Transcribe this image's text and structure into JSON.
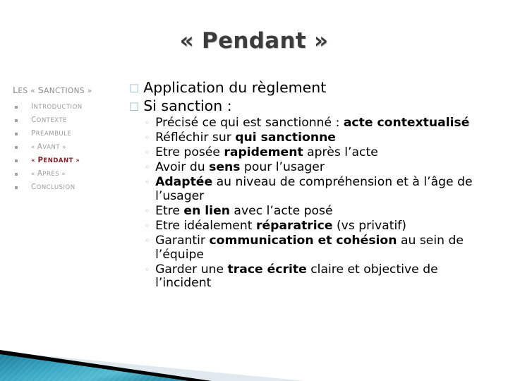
{
  "slide": {
    "title": "« Pendant »",
    "background_color": "#ffffff",
    "title_color": "#3c3c3c"
  },
  "sidebar": {
    "heading": "Les « sanctions »",
    "active_color": "#7b2026",
    "inactive_color": "#9a9a9a",
    "marker_icon": "square-bullet-icon",
    "items": [
      {
        "label": "Introduction",
        "active": false
      },
      {
        "label": "Contexte",
        "active": false
      },
      {
        "label": "Préambule",
        "active": false
      },
      {
        "label": "« Avant »",
        "active": false
      },
      {
        "label": "« Pendant »",
        "active": true
      },
      {
        "label": "« Après »",
        "active": false
      },
      {
        "label": "Conclusion",
        "active": false
      }
    ]
  },
  "content": {
    "level1_marker": "hollow-square-bullet-icon",
    "level1_marker_glyph": "□",
    "level1_marker_color": "#8fb8cc",
    "level2_marker": "hollow-circle-bullet-icon",
    "level2_marker_glyph": "◦",
    "level2_marker_color": "#7fb0c8",
    "bullets": [
      {
        "text": "Application du règlement"
      },
      {
        "text": "Si sanction :"
      }
    ],
    "subbullets": [
      {
        "html": "Précisé ce qui est sanctionné : <b>acte contextualisé</b>"
      },
      {
        "html": "Réfléchir sur <b>qui sanctionne</b>"
      },
      {
        "html": "Etre posée <b>rapidement</b> après l’acte"
      },
      {
        "html": "Avoir du <b>sens</b> pour l’usager"
      },
      {
        "html": "<b>Adaptée</b> au niveau de compréhension et à l’âge de l’usager"
      },
      {
        "html": "Etre <b>en lien</b> avec l’acte posé"
      },
      {
        "html": "Etre idéalement <b>réparatrice</b> (vs privatif)"
      },
      {
        "html": "Garantir <b>communication et cohésion</b> au sein de l’équipe"
      },
      {
        "html": "Garder une <b>trace écrite</b> claire et objective de l’incident"
      }
    ]
  },
  "decoration": {
    "name": "corner-triangle-graphic",
    "teal_dark": "#1d7e9c",
    "teal_mid": "#3aa8c4",
    "teal_light": "#59bcd2",
    "black_stripe": "#000000",
    "pale_band": "#dfe9ee"
  }
}
